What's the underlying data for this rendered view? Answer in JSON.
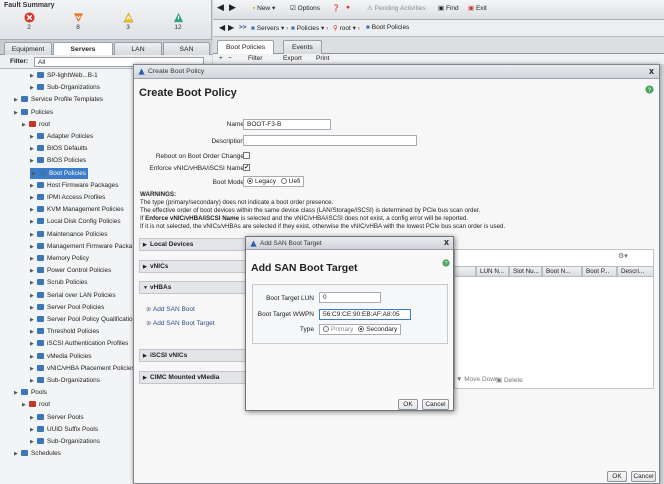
{
  "fault_summary": {
    "title": "Fault Summary",
    "items": [
      {
        "icon": "critical-icon",
        "count": "2",
        "color": "#d8352a"
      },
      {
        "icon": "major-icon",
        "count": "8",
        "color": "#e8742a"
      },
      {
        "icon": "minor-icon",
        "count": "3",
        "color": "#f1c231"
      },
      {
        "icon": "warning-icon",
        "count": "12",
        "color": "#2fa37a"
      }
    ]
  },
  "left_tabs": [
    "Equipment",
    "Servers",
    "LAN",
    "SAN"
  ],
  "filter": {
    "label": "Filter:",
    "value": "All"
  },
  "tree": [
    {
      "label": "SP-lightWeb...B-1",
      "indent": 3
    },
    {
      "label": "Sub-Organizations",
      "indent": 3
    },
    {
      "label": "Service Profile Templates",
      "indent": 1
    },
    {
      "label": "Policies",
      "indent": 1
    },
    {
      "label": "root",
      "indent": 2
    },
    {
      "label": "Adapter Policies",
      "indent": 3
    },
    {
      "label": "BIOS Defaults",
      "indent": 3
    },
    {
      "label": "BIOS Policies",
      "indent": 3
    },
    {
      "label": "Boot Policies",
      "indent": 3,
      "selected": true
    },
    {
      "label": "Host Firmware Packages",
      "indent": 3
    },
    {
      "label": "IPMI Access Profiles",
      "indent": 3
    },
    {
      "label": "KVM Management Policies",
      "indent": 3
    },
    {
      "label": "Local Disk Config Policies",
      "indent": 3
    },
    {
      "label": "Maintenance Policies",
      "indent": 3
    },
    {
      "label": "Management Firmware Packa",
      "indent": 3
    },
    {
      "label": "Memory Policy",
      "indent": 3
    },
    {
      "label": "Power Control Policies",
      "indent": 3
    },
    {
      "label": "Scrub Policies",
      "indent": 3
    },
    {
      "label": "Serial over LAN Policies",
      "indent": 3
    },
    {
      "label": "Server Pool Policies",
      "indent": 3
    },
    {
      "label": "Server Pool Policy Qualificatio",
      "indent": 3
    },
    {
      "label": "Threshold Policies",
      "indent": 3
    },
    {
      "label": "iSCSI Authentication Profiles",
      "indent": 3
    },
    {
      "label": "vMedia Policies",
      "indent": 3
    },
    {
      "label": "vNIC/vHBA Placement Policies",
      "indent": 3
    },
    {
      "label": "Sub-Organizations",
      "indent": 3
    },
    {
      "label": "Pools",
      "indent": 1
    },
    {
      "label": "root",
      "indent": 2
    },
    {
      "label": "Server Pools",
      "indent": 3
    },
    {
      "label": "UUID Suffix Pools",
      "indent": 3
    },
    {
      "label": "Sub-Organizations",
      "indent": 3
    },
    {
      "label": "Schedules",
      "indent": 1
    }
  ],
  "toolbar": {
    "new": "New",
    "options": "Options",
    "pending": "Pending Activities",
    "find": "Find",
    "exit": "Exit"
  },
  "breadcrumb": {
    "servers": "Servers",
    "policies": "Policies",
    "root": "root",
    "current": "Boot Policies"
  },
  "right_tabs": [
    "Boot Policies",
    "Events"
  ],
  "subtool": {
    "filter": "Filter",
    "export": "Export",
    "print": "Print"
  },
  "create_boot_policy": {
    "window_title": "Create Boot Policy",
    "heading": "Create Boot Policy",
    "name_label": "Name",
    "name_value": "BOOT-F3-B",
    "description_label": "Description",
    "description_value": "",
    "reboot_label": "Reboot on Boot Order Change",
    "enforce_label": "Enforce vNIC/vHBA/iSCSI Name",
    "enforce_checked": "✔",
    "boot_mode_label": "Boot Mode",
    "boot_mode_legacy": "Legacy",
    "boot_mode_uefi": "Uefi",
    "warnings_title": "WARNINGS:",
    "warning_1": "The type (primary/secondary) does not indicate a boot order presence.",
    "warning_2": "The effective order of boot devices within the same device class (LAN/Storage/iSCSI) is determined by PCIe bus scan order.",
    "warning_3a": "If ",
    "warning_3b": "Enforce vNIC/vHBA/iSCSI Name",
    "warning_3c": " is selected and the vNIC/vHBA/iSCSI does not exist, a config error will be reported.",
    "warning_4": "If it is not selected, the vNICs/vHBAs are selected if they exist, otherwise the vNIC/vHBA with the lowest PCIe bus scan order is used.",
    "sections": [
      "Local Devices",
      "vNICs",
      "vHBAs",
      "iSCSI vNICs",
      "CIMC Mounted vMedia"
    ],
    "add_san_boot": "Add SAN Boot",
    "add_san_boot_target": "Add SAN Boot Target",
    "grid_headers": [
      "LUN N...",
      "Slot Nu...",
      "Boot N...",
      "Boot P...",
      "Descri..."
    ],
    "move_down": "Move Down",
    "delete": "Delete",
    "ok": "OK",
    "cancel": "Cancel"
  },
  "add_san_boot_target": {
    "window_title": "Add SAN Boot Target",
    "heading": "Add SAN Boot Target",
    "lun_label": "Boot Target LUN",
    "lun_value": "0",
    "wwpn_label": "Boot Target WWPN",
    "wwpn_value": "56:C9:CE:90:EB:AF:A8:05",
    "type_label": "Type",
    "type_primary": "Primary",
    "type_secondary": "Secondary",
    "ok": "OK",
    "cancel": "Cancel"
  }
}
